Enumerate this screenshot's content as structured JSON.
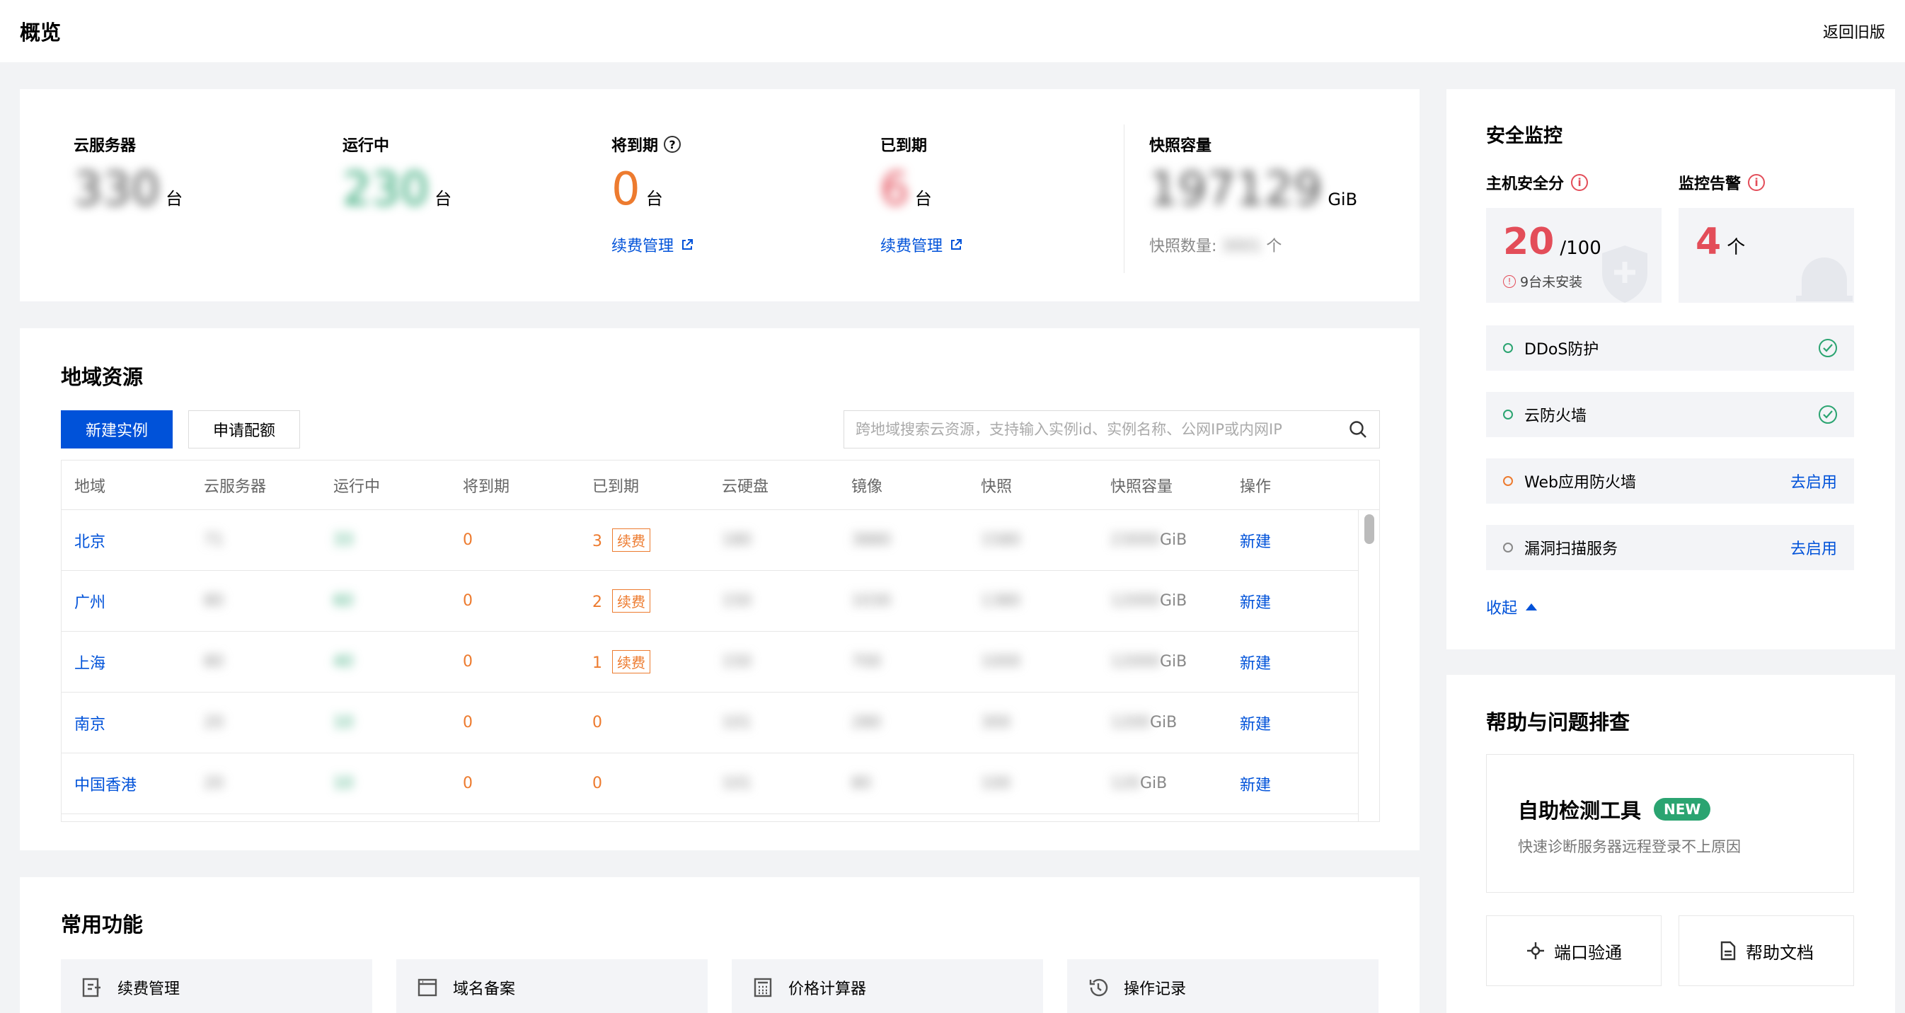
{
  "header": {
    "title": "概览",
    "back_label": "返回旧版"
  },
  "summary": {
    "servers": {
      "label": "云服务器",
      "value": "330",
      "unit": "台"
    },
    "running": {
      "label": "运行中",
      "value": "230",
      "unit": "台"
    },
    "expiring": {
      "label": "将到期",
      "value": "0",
      "unit": "台",
      "link": "续费管理"
    },
    "expired": {
      "label": "已到期",
      "value": "6",
      "unit": "台",
      "link": "续费管理"
    },
    "snapshot": {
      "label": "快照容量",
      "value": "197129",
      "unit": "GiB",
      "count_label": "快照数量:",
      "count_value": "3001",
      "count_unit": "个"
    }
  },
  "region": {
    "title": "地域资源",
    "new_instance": "新建实例",
    "apply_quota": "申请配额",
    "search_placeholder": "跨地域搜索云资源，支持输入实例id、实例名称、公网IP或内网IP",
    "columns": [
      "地域",
      "云服务器",
      "运行中",
      "将到期",
      "已到期",
      "云硬盘",
      "镜像",
      "快照",
      "快照容量",
      "操作"
    ],
    "renew_tag": "续费",
    "action": "新建",
    "rows": [
      {
        "region": "北京",
        "servers": "71",
        "running": "33",
        "expiring": "0",
        "expired": "3",
        "renew": true,
        "disks": "180",
        "images": "3880",
        "snapshots": "1580",
        "capacity": "23000",
        "unit": "GiB"
      },
      {
        "region": "广州",
        "servers": "80",
        "running": "60",
        "expiring": "0",
        "expired": "2",
        "renew": true,
        "disks": "150",
        "images": "1030",
        "snapshots": "1380",
        "capacity": "12000",
        "unit": "GiB"
      },
      {
        "region": "上海",
        "servers": "80",
        "running": "40",
        "expiring": "0",
        "expired": "1",
        "renew": true,
        "disks": "150",
        "images": "700",
        "snapshots": "1000",
        "capacity": "12000",
        "unit": "GiB"
      },
      {
        "region": "南京",
        "servers": "20",
        "running": "10",
        "expiring": "0",
        "expired": "0",
        "renew": false,
        "disks": "101",
        "images": "280",
        "snapshots": "300",
        "capacity": "1200",
        "unit": "GiB"
      },
      {
        "region": "中国香港",
        "servers": "20",
        "running": "10",
        "expiring": "0",
        "expired": "0",
        "renew": false,
        "disks": "101",
        "images": "80",
        "snapshots": "100",
        "capacity": "120",
        "unit": "GiB"
      }
    ]
  },
  "common": {
    "title": "常用功能",
    "items": [
      {
        "label": "续费管理",
        "icon": "renew-icon"
      },
      {
        "label": "域名备案",
        "icon": "window-icon"
      },
      {
        "label": "价格计算器",
        "icon": "calculator-icon"
      },
      {
        "label": "操作记录",
        "icon": "history-icon"
      }
    ]
  },
  "security": {
    "title": "安全监控",
    "host_label": "主机安全分",
    "host_score": "20",
    "host_total": "/100",
    "host_warn": "9台未安装",
    "alarm_label": "监控告警",
    "alarm_count": "4",
    "alarm_unit": "个",
    "services": [
      {
        "name": "DDoS防护",
        "status": "ok",
        "dot": "#2ba471"
      },
      {
        "name": "云防火墙",
        "status": "ok",
        "dot": "#2ba471"
      },
      {
        "name": "Web应用防火墙",
        "status": "off",
        "action": "去启用",
        "dot": "#ed7b2f"
      },
      {
        "name": "漏洞扫描服务",
        "status": "off",
        "action": "去启用",
        "dot": "#888888"
      }
    ],
    "collapse": "收起"
  },
  "help": {
    "title": "帮助与问题排查",
    "tool_title": "自助检测工具",
    "tool_tag": "NEW",
    "tool_desc": "快速诊断服务器远程登录不上原因",
    "port_btn": "端口验通",
    "doc_btn": "帮助文档"
  },
  "colors": {
    "primary": "#0052d9",
    "warning": "#ed7b2f",
    "danger": "#e34d59",
    "success": "#2ba471"
  }
}
